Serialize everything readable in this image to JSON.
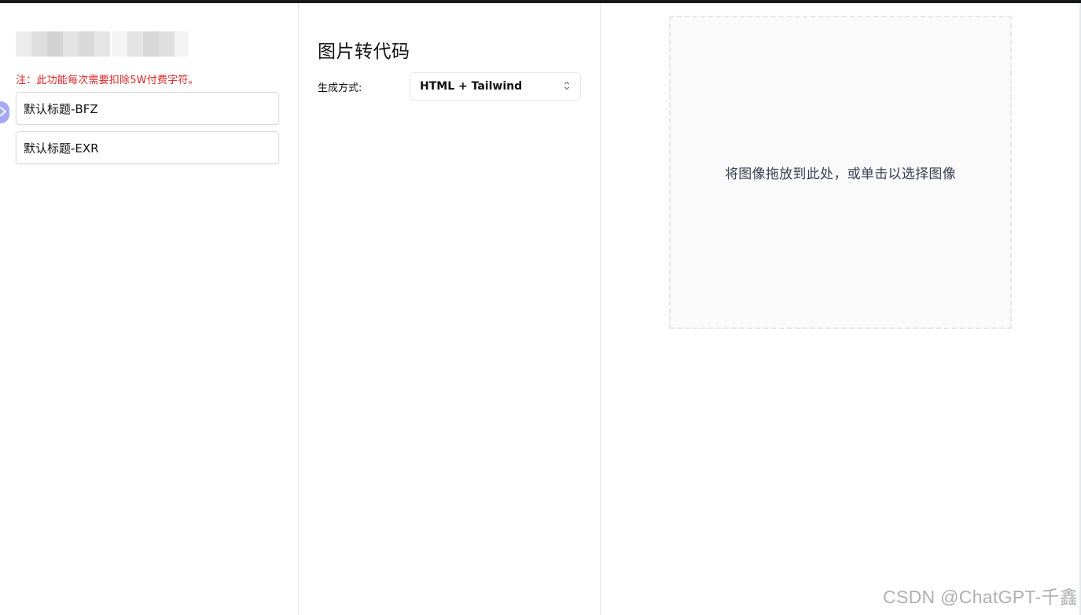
{
  "sidebar": {
    "notice": "注：此功能每次需要扣除5W付费字符。",
    "history_items": [
      {
        "label": "默认标题-BFZ"
      },
      {
        "label": "默认标题-EXR"
      }
    ]
  },
  "main": {
    "title": "图片转代码",
    "method_label": "生成方式:",
    "method_value": "HTML + Tailwind"
  },
  "dropzone": {
    "text": "将图像拖放到此处，或单击以选择图像"
  },
  "watermark": "CSDN @ChatGPT-千鑫",
  "colors": {
    "notice": "#dc2626",
    "accent_handle": "#a5a8f5",
    "top_bar": "#17181b",
    "border": "#e5e7eb",
    "dropzone_bg": "#fafafa"
  },
  "icons": {
    "select_chevron": "chevron-up-down-icon",
    "collapse_handle": "chevron-right-icon"
  }
}
